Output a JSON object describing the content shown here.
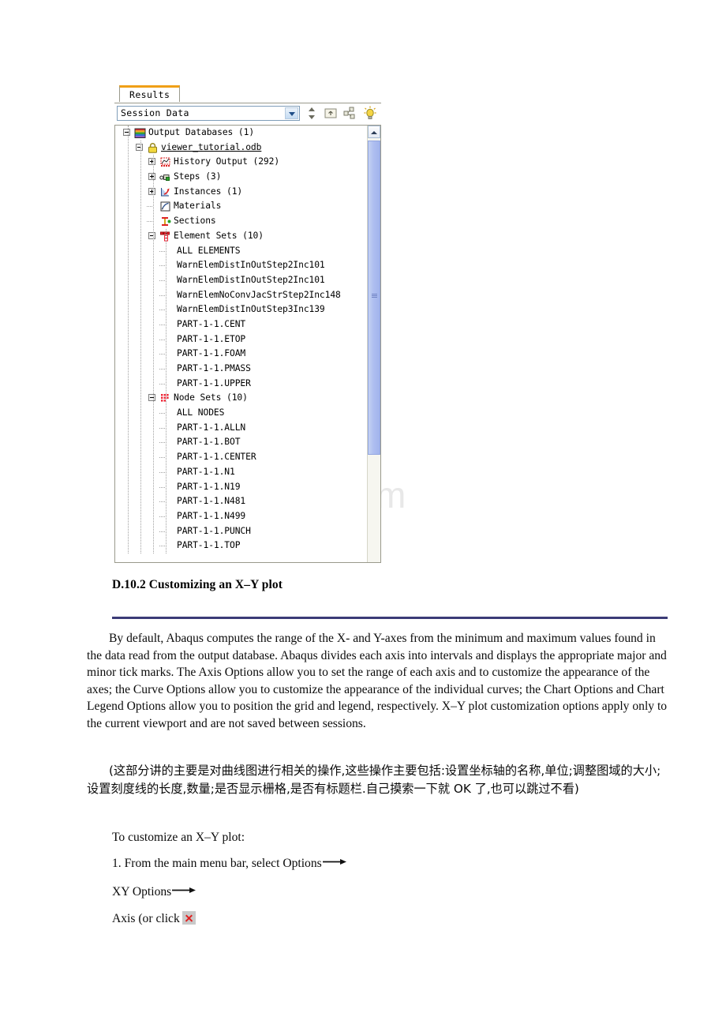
{
  "watermark": {
    "text": "www.bdocx.com"
  },
  "panel": {
    "tab_label": "Results",
    "combo_value": "Session Data",
    "toolbar_icons": [
      {
        "name": "updown-spinner-icon"
      },
      {
        "name": "move-up-folder-icon"
      },
      {
        "name": "link-nodes-icon"
      },
      {
        "name": "lightbulb-icon"
      }
    ],
    "tree": [
      {
        "label": "Output Databases (1)",
        "depth": 0,
        "toggle": "minus",
        "icon": "output-databases-icon"
      },
      {
        "label": "viewer_tutorial.odb",
        "depth": 1,
        "toggle": "minus",
        "icon": "lock-odb-icon",
        "underline": true
      },
      {
        "label": "History Output (292)",
        "depth": 2,
        "toggle": "plus",
        "icon": "history-output-icon"
      },
      {
        "label": "Steps (3)",
        "depth": 2,
        "toggle": "plus",
        "icon": "steps-icon"
      },
      {
        "label": "Instances (1)",
        "depth": 2,
        "toggle": "plus",
        "icon": "instances-icon"
      },
      {
        "label": "Materials",
        "depth": 2,
        "toggle": "none",
        "icon": "materials-icon"
      },
      {
        "label": "Sections",
        "depth": 2,
        "toggle": "none",
        "icon": "sections-icon"
      },
      {
        "label": "Element Sets (10)",
        "depth": 2,
        "toggle": "minus",
        "icon": "element-sets-icon"
      },
      {
        "label": "ALL ELEMENTS",
        "depth": 3,
        "toggle": "none",
        "icon": "none"
      },
      {
        "label": "WarnElemDistInOutStep2Inc101",
        "depth": 3,
        "toggle": "none",
        "icon": "none"
      },
      {
        "label": "WarnElemDistInOutStep2Inc101",
        "depth": 3,
        "toggle": "none",
        "icon": "none"
      },
      {
        "label": "WarnElemNoConvJacStrStep2Inc148",
        "depth": 3,
        "toggle": "none",
        "icon": "none"
      },
      {
        "label": "WarnElemDistInOutStep3Inc139",
        "depth": 3,
        "toggle": "none",
        "icon": "none"
      },
      {
        "label": "PART-1-1.CENT",
        "depth": 3,
        "toggle": "none",
        "icon": "none"
      },
      {
        "label": "PART-1-1.ETOP",
        "depth": 3,
        "toggle": "none",
        "icon": "none"
      },
      {
        "label": "PART-1-1.FOAM",
        "depth": 3,
        "toggle": "none",
        "icon": "none"
      },
      {
        "label": "PART-1-1.PMASS",
        "depth": 3,
        "toggle": "none",
        "icon": "none"
      },
      {
        "label": "PART-1-1.UPPER",
        "depth": 3,
        "toggle": "none",
        "icon": "none"
      },
      {
        "label": "Node Sets (10)",
        "depth": 2,
        "toggle": "minus",
        "icon": "node-sets-icon"
      },
      {
        "label": "ALL NODES",
        "depth": 3,
        "toggle": "none",
        "icon": "none"
      },
      {
        "label": "PART-1-1.ALLN",
        "depth": 3,
        "toggle": "none",
        "icon": "none"
      },
      {
        "label": "PART-1-1.BOT",
        "depth": 3,
        "toggle": "none",
        "icon": "none"
      },
      {
        "label": "PART-1-1.CENTER",
        "depth": 3,
        "toggle": "none",
        "icon": "none"
      },
      {
        "label": "PART-1-1.N1",
        "depth": 3,
        "toggle": "none",
        "icon": "none"
      },
      {
        "label": "PART-1-1.N19",
        "depth": 3,
        "toggle": "none",
        "icon": "none"
      },
      {
        "label": "PART-1-1.N481",
        "depth": 3,
        "toggle": "none",
        "icon": "none"
      },
      {
        "label": "PART-1-1.N499",
        "depth": 3,
        "toggle": "none",
        "icon": "none"
      },
      {
        "label": "PART-1-1.PUNCH",
        "depth": 3,
        "toggle": "none",
        "icon": "none"
      },
      {
        "label": "PART-1-1.TOP",
        "depth": 3,
        "toggle": "none",
        "icon": "none"
      }
    ]
  },
  "document": {
    "heading": "D.10.2 Customizing an X–Y plot",
    "paragraph1": "By default, Abaqus computes the range of the X- and Y-axes from the minimum and maximum values found in the data read from the output database. Abaqus divides each axis into intervals and displays the appropriate major and minor tick marks. The Axis Options allow you to set the range of each axis and to customize the appearance of the axes; the Curve Options allow you to customize the appearance of the individual curves; the Chart Options and Chart Legend Options allow you to position the grid and legend, respectively. X–Y plot customization options apply only to the current viewport and are not saved between sessions.",
    "paragraph2": "(这部分讲的主要是对曲线图进行相关的操作,这些操作主要包括:设置坐标轴的名称,单位;调整图域的大小;设置刻度线的长度,数量;是否显示栅格,是否有标题栏.自己摸索一下就 OK 了,也可以跳过不看)",
    "line_intro": "To customize an X–Y plot:",
    "line_step1": "1. From the main menu bar, select Options",
    "line_step1b": "XY Options",
    "line_step1c": "Axis (or click"
  },
  "colors": {
    "rule": "#3b3b77",
    "tab_accent": "#f0a017",
    "scroll_thumb": "#aebef0",
    "x_icon_red": "#e02020"
  }
}
